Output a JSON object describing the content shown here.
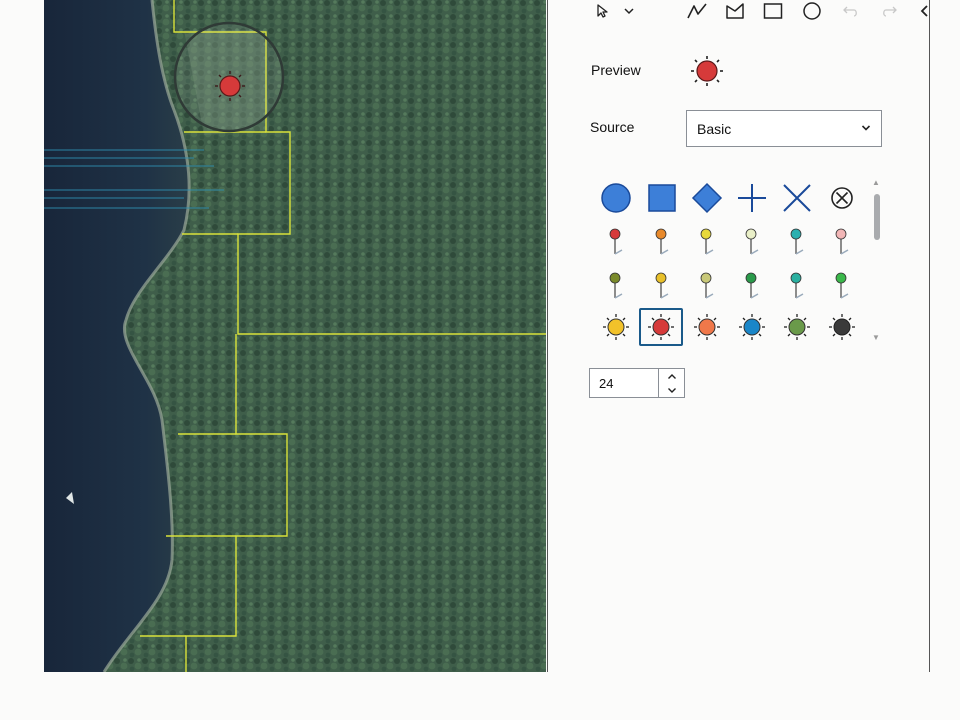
{
  "toolbar": {
    "tools": [
      {
        "name": "select-tool-icon"
      },
      {
        "name": "chevron-down-icon"
      },
      {
        "name": "polyline-tool-icon"
      },
      {
        "name": "polygon-tool-icon"
      },
      {
        "name": "rectangle-tool-icon"
      },
      {
        "name": "circle-tool-icon"
      },
      {
        "name": "undo-icon"
      },
      {
        "name": "redo-icon"
      },
      {
        "name": "collapse-panel-icon"
      }
    ]
  },
  "panel": {
    "preview_label": "Preview",
    "source_label": "Source",
    "source_value": "Basic",
    "size_value": "24"
  },
  "symbols": {
    "shapes": [
      "circle",
      "square",
      "diamond",
      "cross",
      "x",
      "x-circle"
    ],
    "pin_colors_row1": [
      "#d63a3a",
      "#e8892a",
      "#e8d93a",
      "#eaf0c8",
      "#2ab0b0",
      "#f2b6b6"
    ],
    "pin_colors_row2": [
      "#7a8a2a",
      "#e8c02a",
      "#c8c878",
      "#2a9a4a",
      "#2ab0a0",
      "#3ab84a"
    ],
    "sun_colors": [
      "#f2c22a",
      "#d63a3a",
      "#f0784a",
      "#1a86c8",
      "#6a9a4a",
      "#3a3a3a"
    ],
    "selected": "sun-red",
    "accent": "#1a5a8a"
  }
}
